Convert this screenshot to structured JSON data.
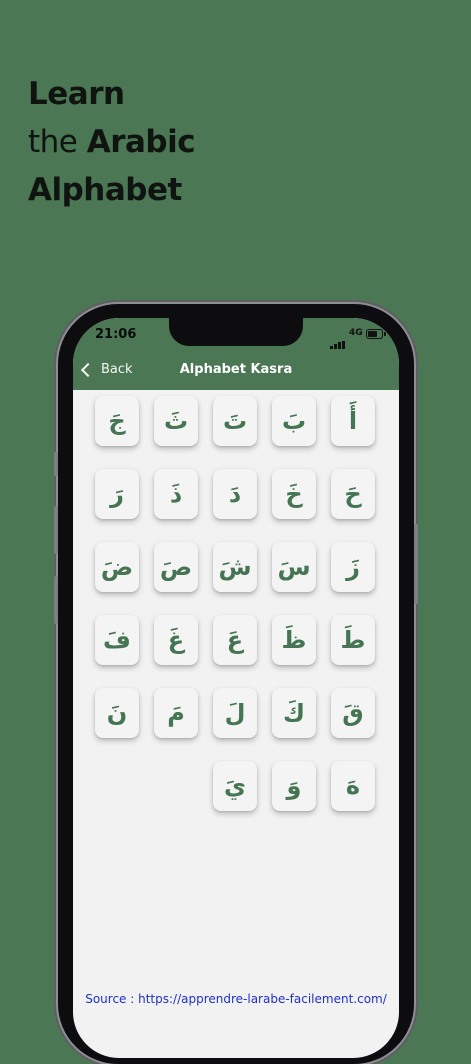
{
  "headline": {
    "line1": "Learn",
    "line2_prefix": "the",
    "line2_bold": "Arabic",
    "line3": "Alphabet"
  },
  "status_bar": {
    "time": "21:06",
    "network": "4G"
  },
  "nav": {
    "back_label": "Back",
    "title": "Alphabet Kasra"
  },
  "letters": [
    [
      "جَ",
      "ثَ",
      "تَ",
      "بَ",
      "أَ"
    ],
    [
      "رَ",
      "ذَ",
      "دَ",
      "خَ",
      "حَ"
    ],
    [
      "ضَ",
      "صَ",
      "شَ",
      "سَ",
      "زَ"
    ],
    [
      "فَ",
      "غَ",
      "عَ",
      "ظَ",
      "طَ"
    ],
    [
      "نَ",
      "مَ",
      "لَ",
      "كَ",
      "قَ"
    ],
    [
      "",
      "",
      "يَ",
      "وَ",
      "هَ"
    ]
  ],
  "footer": {
    "source": "Source : https://apprendre-larabe-facilement.com/"
  },
  "colors": {
    "background": "#4b7754",
    "letter": "#457552",
    "link": "#1f31c8"
  }
}
